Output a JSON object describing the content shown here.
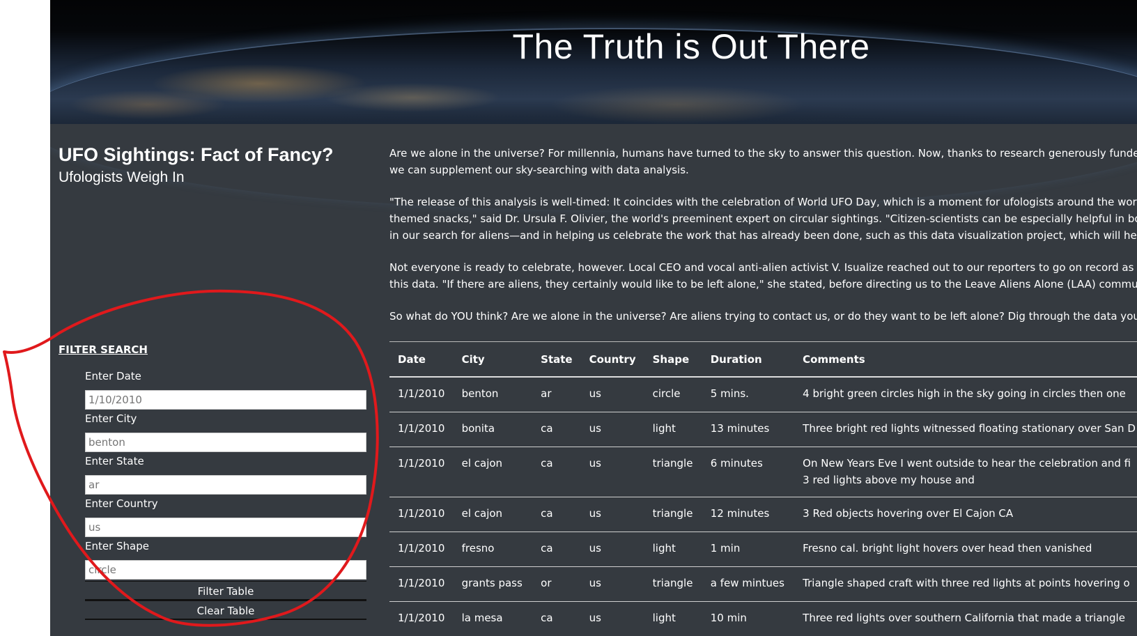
{
  "banner": {
    "title": "The Truth is Out There"
  },
  "sidebar": {
    "title": "UFO Sightings: Fact of Fancy?",
    "subtitle": "Ufologists Weigh In",
    "filter_heading": "FILTER SEARCH",
    "fields": [
      {
        "label": "Enter Date",
        "placeholder": "1/10/2010"
      },
      {
        "label": "Enter City",
        "placeholder": "benton"
      },
      {
        "label": "Enter State",
        "placeholder": "ar"
      },
      {
        "label": "Enter Country",
        "placeholder": "us"
      },
      {
        "label": "Enter Shape",
        "placeholder": "circle"
      }
    ],
    "filter_button": "Filter Table",
    "clear_button": "Clear Table"
  },
  "article": {
    "p1a": "Are we alone in the universe? For millennia, humans have turned to the sky to answer this question. Now, thanks to research generously funded by W. Av",
    "p1b": "we can supplement our sky-searching with data analysis.",
    "p2a": "\"The release of this analysis is well-timed: It coincides with the celebration of World UFO Day, which is a moment for ufologists around the world to conn",
    "p2b": "themed snacks,\" said Dr. Ursula F. Olivier, the world's preeminent expert on circular sightings. \"Citizen-scientists can be especially helpful in both catalog",
    "p2c": "in our search for aliens—and in helping us celebrate the work that has already been done, such as this data visualization project, which will help us raise",
    "p3a": "Not everyone is ready to celebrate, however. Local CEO and vocal anti-alien activist V. Isualize reached out to our reporters to go on record as firmly opp",
    "p3b": "this data. \"If there are aliens, they certainly would like to be left alone,\" she stated, before directing us to the Leave Aliens Alone (LAA) community engag",
    "p4a": "So what do YOU think? Are we alone in the universe? Are aliens trying to contact us, or do they want to be left alone? Dig through the data yourself, and"
  },
  "table": {
    "headers": [
      "Date",
      "City",
      "State",
      "Country",
      "Shape",
      "Duration",
      "Comments"
    ],
    "rows": [
      [
        "1/1/2010",
        "benton",
        "ar",
        "us",
        "circle",
        "5 mins.",
        "4 bright green circles high in the sky going in circles then one",
        ""
      ],
      [
        "1/1/2010",
        "bonita",
        "ca",
        "us",
        "light",
        "13 minutes",
        "Three bright red lights witnessed floating stationary over San D",
        ""
      ],
      [
        "1/1/2010",
        "el cajon",
        "ca",
        "us",
        "triangle",
        "6 minutes",
        "On New Years Eve I went outside to hear the celebration and fi",
        "3 red lights above my house and"
      ],
      [
        "1/1/2010",
        "el cajon",
        "ca",
        "us",
        "triangle",
        "12 minutes",
        "3 Red objects hovering over El Cajon CA",
        ""
      ],
      [
        "1/1/2010",
        "fresno",
        "ca",
        "us",
        "light",
        "1 min",
        "Fresno cal. bright light hovers over head then vanished",
        ""
      ],
      [
        "1/1/2010",
        "grants pass",
        "or",
        "us",
        "triangle",
        "a few mintues",
        "Triangle shaped craft with three red lights at points hovering o",
        ""
      ],
      [
        "1/1/2010",
        "la mesa",
        "ca",
        "us",
        "light",
        "10 min",
        "Three red lights over southern California that made a triangle",
        ""
      ]
    ]
  },
  "annotation": {
    "color": "#e0191c"
  }
}
